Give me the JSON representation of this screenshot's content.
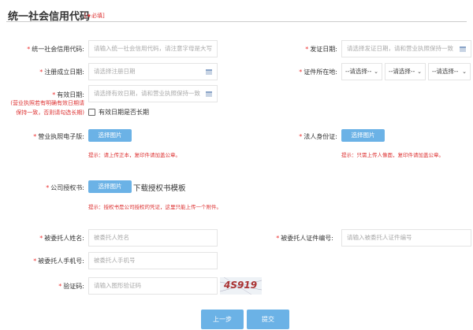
{
  "header": {
    "title": "统一社会信用代码",
    "required_note": "[★必填]"
  },
  "star": "*",
  "fields": {
    "credit_code": {
      "label": "统一社会信用代码:",
      "placeholder": "请输入统一社会信用代码，请注意字母是大写"
    },
    "issue_date": {
      "label": "发证日期:",
      "placeholder": "请选择发证日期，请和营业执照保持一致"
    },
    "reg_date": {
      "label": "注册成立日期:",
      "placeholder": "请选择注册日期"
    },
    "location": {
      "label": "证件所在地:",
      "selects": [
        "--请选择--",
        "--请选择--",
        "--请选择--"
      ]
    },
    "valid_date": {
      "label": "有效日期:",
      "placeholder": "请选择有效日期，请和营业执照保持一致",
      "note": [
        "(营业执照若有明确有效日期请",
        "保持一致，否则请勾选长期)"
      ],
      "checkbox_label": "有效日期是否长期",
      "checked": false
    },
    "license": {
      "label": "营业执照电子版:",
      "button": "选择图片",
      "hint": "提示：请上传正本，复印件请加盖公章。"
    },
    "legal_id": {
      "label": "法人身份证:",
      "button": "选择图片",
      "hint": "提示：只需上传人像面，复印件请加盖公章。"
    },
    "authorization": {
      "label": "公司授权书:",
      "button": "选择图片",
      "download_link": "下载授权书模板",
      "hint": "提示：授权书是公司授权的凭证，这里只能上传一个附件。"
    },
    "agent_name": {
      "label": "被委托人姓名:",
      "placeholder": "被委托人姓名"
    },
    "agent_id": {
      "label": "被委托人证件编号:",
      "placeholder": "请输入被委托人证件编号"
    },
    "agent_phone": {
      "label": "被委托人手机号:",
      "placeholder": "被委托人手机号"
    },
    "captcha": {
      "label": "验证码:",
      "placeholder": "请输入图形验证码",
      "image_text": "4S919"
    }
  },
  "actions": {
    "prev": "上一步",
    "submit": "提交"
  }
}
